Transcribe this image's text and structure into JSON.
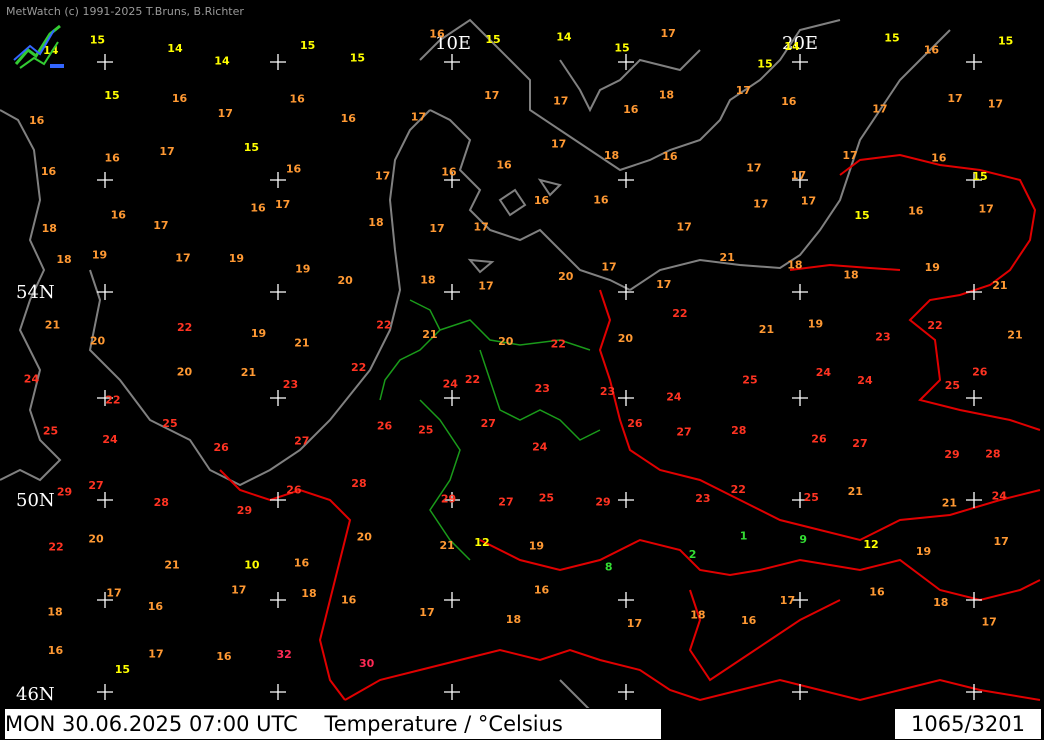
{
  "credit": "MetWatch  (c) 1991-2025 T.Bruns, B.Richter",
  "grid_labels": {
    "lon_10e": "10E",
    "lon_20e": "20E",
    "lat_54n": "54N",
    "lat_50n": "50N",
    "lat_46n": "46N"
  },
  "footer": {
    "datetime": "MON 30.06.2025 07:00 UTC",
    "title": "Temperature / °Celsius",
    "counter": "1065/3201"
  },
  "colors": {
    "background": "#000000",
    "coast": "#808080",
    "border": "#e00000",
    "state_border": "#1a9a1a",
    "cold": "#ffff00",
    "cool": "#ff9933",
    "warm": "#ff3322",
    "hot": "#ff2a55",
    "green": "#33dd33"
  },
  "legend_icon": "metwatch-logo-icon",
  "temperature_band_keys": [
    "cold",
    "cool",
    "warm",
    "hot"
  ],
  "observations": [
    {
      "t": 14
    },
    {
      "t": 15
    },
    {
      "t": 14
    },
    {
      "t": 14
    },
    {
      "t": 15
    },
    {
      "t": 15
    },
    {
      "t": 16
    },
    {
      "t": 15
    },
    {
      "t": 14
    },
    {
      "t": 15
    },
    {
      "t": 17
    },
    {
      "t": 15
    },
    {
      "t": 14
    },
    {
      "t": 15
    },
    {
      "t": 16
    },
    {
      "t": 15
    },
    {
      "t": 16
    },
    {
      "t": 15
    },
    {
      "t": 16
    },
    {
      "t": 17
    },
    {
      "t": 16
    },
    {
      "t": 16
    },
    {
      "t": 17
    },
    {
      "t": 17
    },
    {
      "t": 17
    },
    {
      "t": 16
    },
    {
      "t": 18
    },
    {
      "t": 17
    },
    {
      "t": 16
    },
    {
      "t": 17
    },
    {
      "t": 17
    },
    {
      "t": 17
    },
    {
      "t": 16
    },
    {
      "t": 16
    },
    {
      "t": 17
    },
    {
      "t": 15
    },
    {
      "t": 16
    },
    {
      "t": 17
    },
    {
      "t": 16
    },
    {
      "t": 16
    },
    {
      "t": 17
    },
    {
      "t": 18
    },
    {
      "t": 16
    },
    {
      "t": 17
    },
    {
      "t": 17
    },
    {
      "t": 17
    },
    {
      "t": 16
    },
    {
      "t": 15
    },
    {
      "t": 18
    },
    {
      "t": 16
    },
    {
      "t": 17
    },
    {
      "t": 16
    },
    {
      "t": 17
    },
    {
      "t": 18
    },
    {
      "t": 17
    },
    {
      "t": 17
    },
    {
      "t": 16
    },
    {
      "t": 16
    },
    {
      "t": 17
    },
    {
      "t": 17
    },
    {
      "t": 17
    },
    {
      "t": 15
    },
    {
      "t": 16
    },
    {
      "t": 17
    },
    {
      "t": 18
    },
    {
      "t": 19
    },
    {
      "t": 17
    },
    {
      "t": 19
    },
    {
      "t": 19
    },
    {
      "t": 20
    },
    {
      "t": 18
    },
    {
      "t": 17
    },
    {
      "t": 20
    },
    {
      "t": 17
    },
    {
      "t": 17
    },
    {
      "t": 21
    },
    {
      "t": 18
    },
    {
      "t": 18
    },
    {
      "t": 19
    },
    {
      "t": 21
    },
    {
      "t": 21
    },
    {
      "t": 20
    },
    {
      "t": 22
    },
    {
      "t": 19
    },
    {
      "t": 21
    },
    {
      "t": 22
    },
    {
      "t": 21
    },
    {
      "t": 20
    },
    {
      "t": 22
    },
    {
      "t": 20
    },
    {
      "t": 22
    },
    {
      "t": 21
    },
    {
      "t": 19
    },
    {
      "t": 23
    },
    {
      "t": 22
    },
    {
      "t": 21
    },
    {
      "t": 24
    },
    {
      "t": 22
    },
    {
      "t": 20
    },
    {
      "t": 21
    },
    {
      "t": 23
    },
    {
      "t": 22
    },
    {
      "t": 24
    },
    {
      "t": 22
    },
    {
      "t": 23
    },
    {
      "t": 23
    },
    {
      "t": 24
    },
    {
      "t": 25
    },
    {
      "t": 24
    },
    {
      "t": 24
    },
    {
      "t": 25
    },
    {
      "t": 26
    },
    {
      "t": 25
    },
    {
      "t": 24
    },
    {
      "t": 25
    },
    {
      "t": 26
    },
    {
      "t": 27
    },
    {
      "t": 26
    },
    {
      "t": 25
    },
    {
      "t": 27
    },
    {
      "t": 24
    },
    {
      "t": 26
    },
    {
      "t": 27
    },
    {
      "t": 28
    },
    {
      "t": 26
    },
    {
      "t": 27
    },
    {
      "t": 29
    },
    {
      "t": 28
    },
    {
      "t": 29
    },
    {
      "t": 27
    },
    {
      "t": 28
    },
    {
      "t": 29
    },
    {
      "t": 26
    },
    {
      "t": 28
    },
    {
      "t": 29
    },
    {
      "t": 27
    },
    {
      "t": 25
    },
    {
      "t": 29
    },
    {
      "t": 23
    },
    {
      "t": 22
    },
    {
      "t": 25
    },
    {
      "t": 21
    },
    {
      "t": 21
    },
    {
      "t": 24
    },
    {
      "t": 22
    },
    {
      "t": 20
    },
    {
      "t": 21
    },
    {
      "t": 10
    },
    {
      "t": 16
    },
    {
      "t": 20
    },
    {
      "t": 21
    },
    {
      "t": 12
    },
    {
      "t": 19
    },
    {
      "t": 8
    },
    {
      "t": 2
    },
    {
      "t": 1
    },
    {
      "t": 9
    },
    {
      "t": 12
    },
    {
      "t": 19
    },
    {
      "t": 17
    },
    {
      "t": 18
    },
    {
      "t": 17
    },
    {
      "t": 16
    },
    {
      "t": 17
    },
    {
      "t": 18
    },
    {
      "t": 16
    },
    {
      "t": 17
    },
    {
      "t": 18
    },
    {
      "t": 16
    },
    {
      "t": 17
    },
    {
      "t": 18
    },
    {
      "t": 16
    },
    {
      "t": 17
    },
    {
      "t": 16
    },
    {
      "t": 18
    },
    {
      "t": 17
    },
    {
      "t": 16
    },
    {
      "t": 15
    },
    {
      "t": 17
    },
    {
      "t": 16
    },
    {
      "t": 32
    },
    {
      "t": 30
    }
  ]
}
